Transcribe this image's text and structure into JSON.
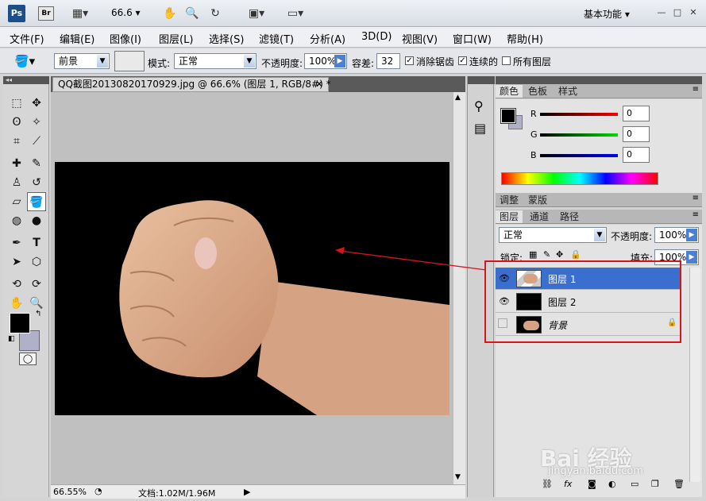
{
  "app": {
    "logo": "Ps",
    "bridge": "Br",
    "zoom": "66.6",
    "workspace": "基本功能"
  },
  "menu": [
    "文件(F)",
    "编辑(E)",
    "图像(I)",
    "图层(L)",
    "选择(S)",
    "滤镜(T)",
    "分析(A)",
    "3D(D)",
    "视图(V)",
    "窗口(W)",
    "帮助(H)"
  ],
  "options": {
    "fill_source": "前景",
    "mode_label": "模式:",
    "mode_value": "正常",
    "opacity_label": "不透明度:",
    "opacity_value": "100%",
    "tolerance_label": "容差:",
    "tolerance_value": "32",
    "antialias": "消除锯齿",
    "contiguous": "连续的",
    "all_layers": "所有图层"
  },
  "document": {
    "tab_title": "QQ截图20130820170929.jpg @ 66.6% (图层 1, RGB/8#) *",
    "zoom_status": "66.55%",
    "doc_size": "文档:1.02M/1.96M"
  },
  "color_panel": {
    "tabs": [
      "颜色",
      "色板",
      "样式"
    ],
    "r_label": "R",
    "g_label": "G",
    "b_label": "B",
    "r": "0",
    "g": "0",
    "b": "0"
  },
  "adjust_panel": {
    "tabs": [
      "调整",
      "蒙版"
    ]
  },
  "layers_panel": {
    "tabs": [
      "图层",
      "通道",
      "路径"
    ],
    "blend_mode": "正常",
    "opacity_label": "不透明度:",
    "opacity": "100%",
    "lock_label": "锁定:",
    "fill_label": "填充:",
    "fill": "100%",
    "layers": [
      {
        "name": "图层 1",
        "visible": true,
        "selected": true
      },
      {
        "name": "图层 2",
        "visible": true,
        "selected": false
      },
      {
        "name": "背景",
        "visible": false,
        "selected": false
      }
    ]
  },
  "watermark": {
    "brand": "Bai 经验",
    "url": "jingyan.baidu.com"
  },
  "colors": {
    "selection_blue": "#3a6fd0",
    "annotation_red": "#d8141b",
    "foreground": "#000000",
    "background": "#b0b0c8"
  }
}
